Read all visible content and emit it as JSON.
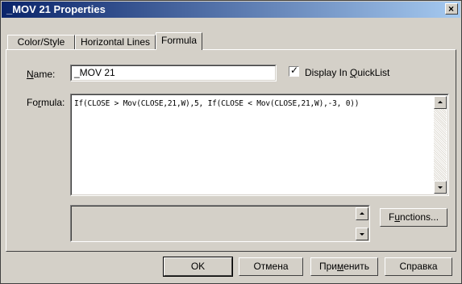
{
  "window": {
    "title": "_MOV 21 Properties",
    "close_glyph": "×"
  },
  "tabs": [
    {
      "label": "Color/Style",
      "active": false
    },
    {
      "label": "Horizontal Lines",
      "active": false
    },
    {
      "label": "Formula",
      "active": true
    }
  ],
  "form": {
    "name_label_first": "N",
    "name_label_rest": "ame:",
    "name_value": "_MOV 21",
    "quicklist_checked": true,
    "quicklist_check_glyph": "✓",
    "quicklist_label_prefix": "Display In ",
    "quicklist_label_underlined": "Q",
    "quicklist_label_suffix": "uickList",
    "formula_label_prefix": "Fo",
    "formula_label_underlined": "r",
    "formula_label_suffix": "mula:",
    "formula_value": "If(CLOSE > Mov(CLOSE,21,W),5, If(CLOSE < Mov(CLOSE,21,W),-3, 0))",
    "description_value": ""
  },
  "buttons": {
    "functions_prefix": "F",
    "functions_underlined": "u",
    "functions_suffix": "nctions...",
    "ok": "OK",
    "cancel": "Отмена",
    "apply_prefix": "При",
    "apply_underlined": "м",
    "apply_suffix": "енить",
    "help": "Справка"
  },
  "icons": {
    "close": "close-icon",
    "scroll_up": "scroll-up-arrow-icon",
    "scroll_down": "scroll-down-arrow-icon",
    "checkmark": "checkmark-icon"
  },
  "colors": {
    "titlebar_start": "#0a246a",
    "titlebar_end": "#a6caf0",
    "face": "#d4d0c8"
  }
}
